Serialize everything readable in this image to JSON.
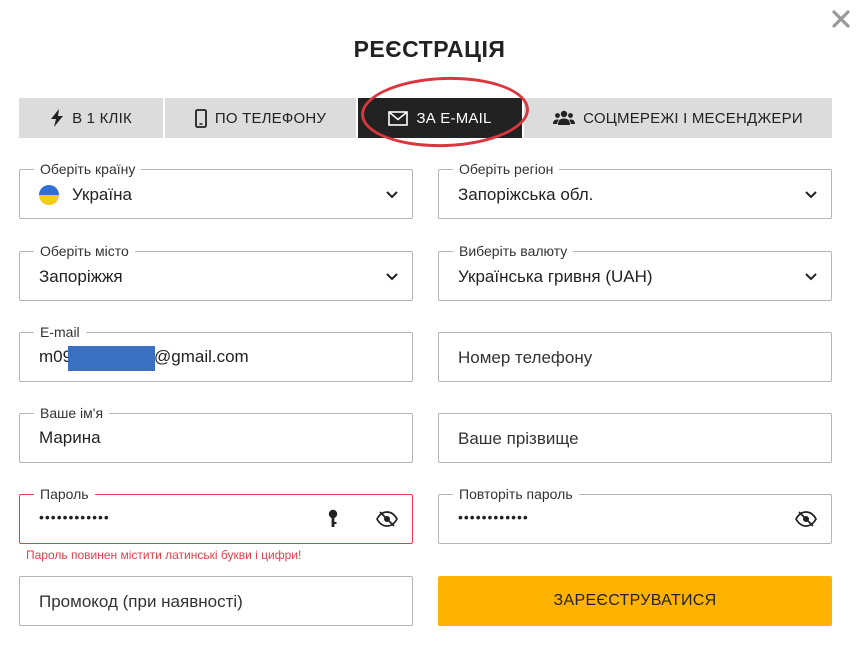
{
  "dialog": {
    "title": "РЕЄСТРАЦІЯ",
    "close_icon": "close-icon"
  },
  "tabs": [
    {
      "label": "В 1 КЛІК",
      "icon": "lightning-icon",
      "active": false
    },
    {
      "label": "ПО ТЕЛЕФОНУ",
      "icon": "phone-icon",
      "active": false
    },
    {
      "label": "ЗА E-MAIL",
      "icon": "envelope-icon",
      "active": true
    },
    {
      "label": "СОЦМЕРЕЖІ І МЕСЕНДЖЕРИ",
      "icon": "users-icon",
      "active": false
    }
  ],
  "form": {
    "country": {
      "label": "Оберіть країну",
      "value": "Україна",
      "flag_colors": [
        "#2f6fd6",
        "#f5cc1a"
      ]
    },
    "region": {
      "label": "Оберіть регіон",
      "value": "Запоріжська обл."
    },
    "city": {
      "label": "Оберіть місто",
      "value": "Запоріжжя"
    },
    "currency": {
      "label": "Виберіть валюту",
      "value": "Українська гривня (UAH)"
    },
    "email": {
      "label": "E-mail",
      "value_prefix": "m09",
      "value_suffix": "@gmail.com"
    },
    "phone": {
      "placeholder": "Номер телефону"
    },
    "first_name": {
      "label": "Ваше ім'я",
      "value": "Марина"
    },
    "last_name": {
      "placeholder": "Ваше прізвище"
    },
    "password": {
      "label": "Пароль",
      "value": "••••••••••••",
      "error": "Пароль повинен містити латинські букви і цифри!"
    },
    "password_repeat": {
      "label": "Повторіть пароль",
      "value": "••••••••••••"
    },
    "promo": {
      "placeholder": "Промокод (при наявності)"
    },
    "submit_label": "ЗАРЕЄСТРУВАТИСЯ"
  },
  "colors": {
    "accent": "#ffb300",
    "active_tab": "#222222",
    "tab_bg": "#dcdcdc",
    "error": "#e0404a",
    "highlight_ring": "#d9363e"
  }
}
